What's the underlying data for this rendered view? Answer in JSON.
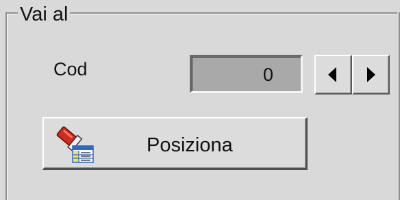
{
  "group": {
    "title": "Vai al"
  },
  "cod": {
    "label": "Cod",
    "value": "0"
  },
  "spinner": {
    "prev_icon": "triangle-left-icon",
    "next_icon": "triangle-right-icon"
  },
  "position_button": {
    "label": "Posiziona",
    "icon": "flashlight-table-icon"
  },
  "colors": {
    "background": "#d9d9d9",
    "field_fill": "#a9a9a9",
    "flashlight_red": "#d42a1e",
    "table_yellow": "#f2e25a",
    "table_blue": "#2f66c8"
  }
}
